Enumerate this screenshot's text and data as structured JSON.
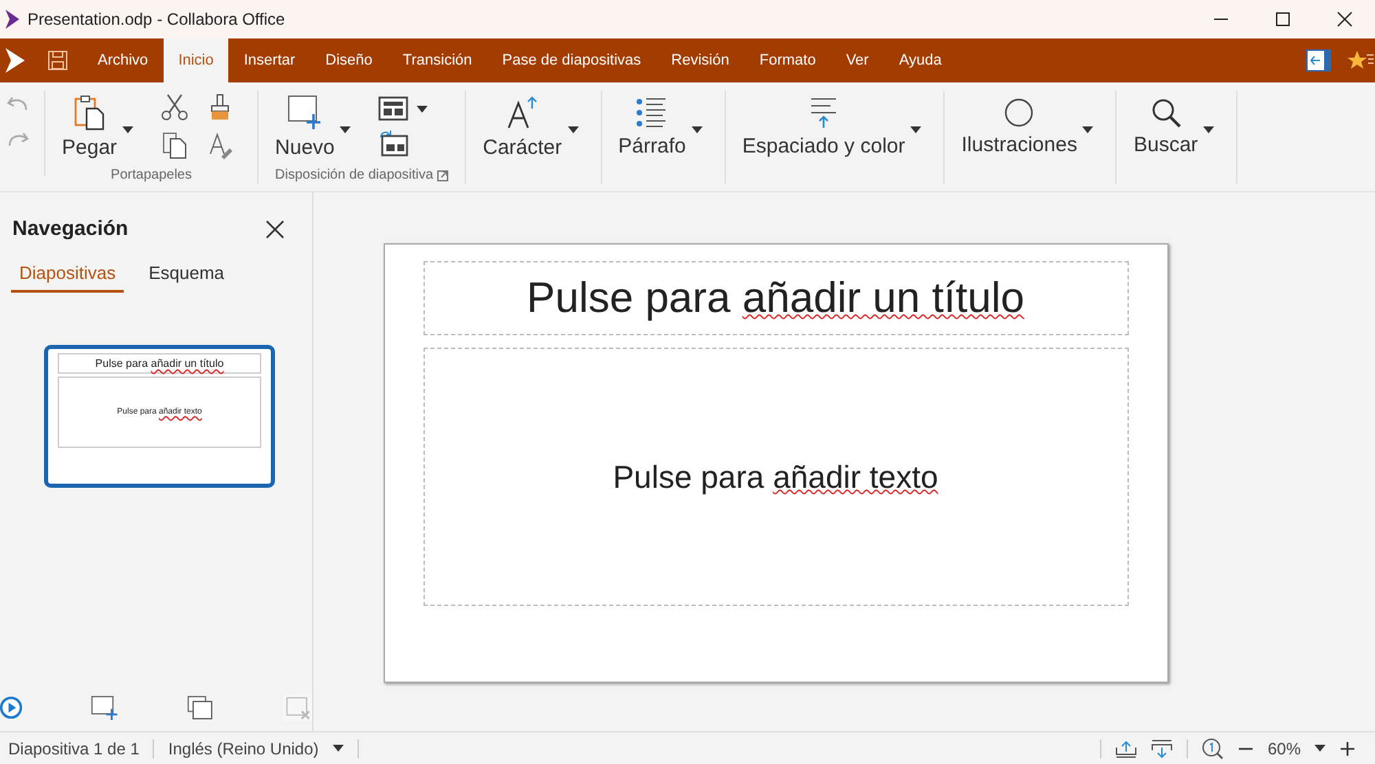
{
  "window": {
    "title": "Presentation.odp - Collabora Office"
  },
  "menu": {
    "tabs": [
      {
        "label": "Archivo",
        "selected": false
      },
      {
        "label": "Inicio",
        "selected": true
      },
      {
        "label": "Insertar",
        "selected": false
      },
      {
        "label": "Diseño",
        "selected": false
      },
      {
        "label": "Transición",
        "selected": false
      },
      {
        "label": "Pase de diapositivas",
        "selected": false
      },
      {
        "label": "Revisión",
        "selected": false
      },
      {
        "label": "Formato",
        "selected": false
      },
      {
        "label": "Ver",
        "selected": false
      },
      {
        "label": "Ayuda",
        "selected": false
      }
    ]
  },
  "ribbon": {
    "groups": [
      {
        "kind": "clipboard",
        "button": "Pegar",
        "label": "Portapapeles"
      },
      {
        "kind": "layout",
        "button": "Nuevo",
        "label": "Disposición de diapositiva"
      },
      {
        "kind": "character",
        "button": "Carácter"
      },
      {
        "kind": "paragraph",
        "button": "Párrafo"
      },
      {
        "kind": "spacing",
        "button": "Espaciado y color"
      },
      {
        "kind": "shapes",
        "button": "Ilustraciones"
      },
      {
        "kind": "search",
        "button": "Buscar"
      }
    ]
  },
  "navigator": {
    "title": "Navegación",
    "tabs": [
      {
        "label": "Diapositivas",
        "selected": true
      },
      {
        "label": "Esquema",
        "selected": false
      }
    ],
    "thumbnails": [
      {
        "selected": true,
        "title": {
          "text": "Pulse para",
          "flagged": "añadir un título"
        },
        "body": {
          "text": "Pulse para",
          "flagged": "añadir texto"
        }
      }
    ],
    "actions": [
      {
        "kind": "play",
        "disabled": false
      },
      {
        "kind": "new",
        "disabled": false
      },
      {
        "kind": "duplicate",
        "disabled": false
      },
      {
        "kind": "delete",
        "disabled": true
      }
    ]
  },
  "slide": {
    "title": {
      "text": "Pulse para",
      "flagged": "añadir un título"
    },
    "body": {
      "text": "Pulse para",
      "flagged": "añadir texto"
    }
  },
  "status_bar": {
    "slide": "Diapositiva 1 de 1",
    "language": "Inglés (Reino Unido)",
    "zoom": "60%"
  }
}
